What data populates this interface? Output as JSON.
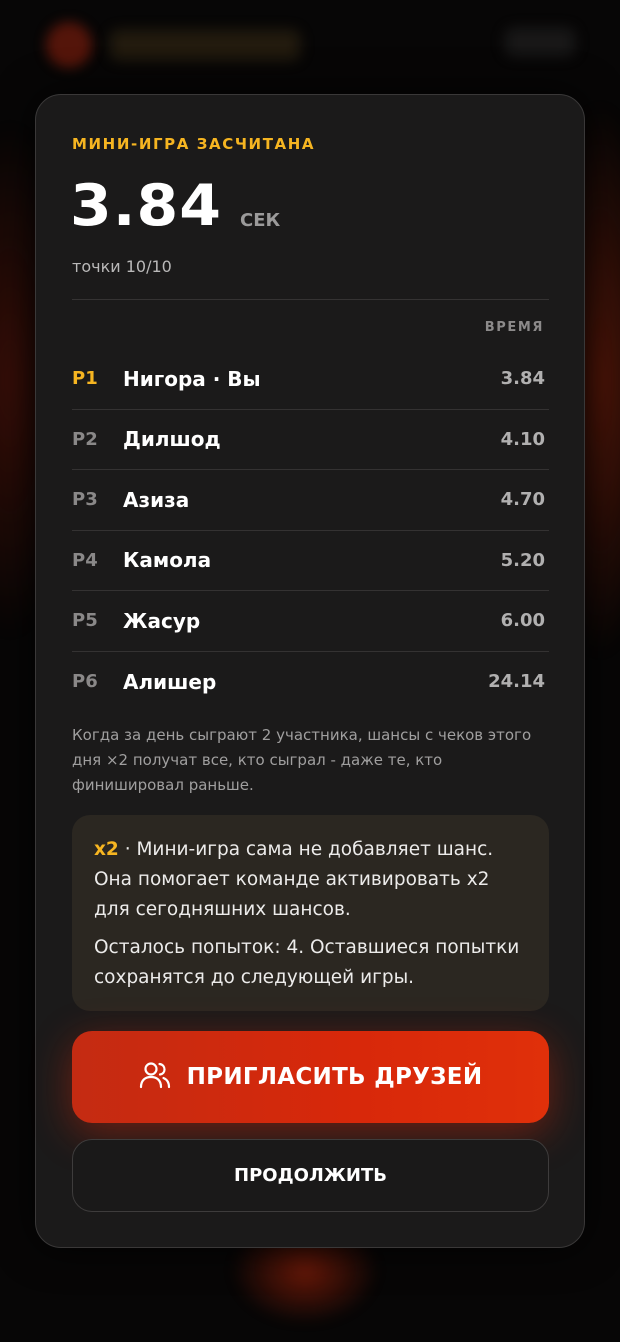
{
  "result": {
    "eyebrow": "МИНИ-ИГРА ЗАСЧИТАНА",
    "score_value": "3.84",
    "score_unit": "СЕК",
    "points_label": "точки 10/10"
  },
  "leaderboard": {
    "column_header": "ВРЕМЯ",
    "rows": [
      {
        "rank": "P1",
        "name": "Нигора · Вы",
        "time": "3.84"
      },
      {
        "rank": "P2",
        "name": "Дилшод",
        "time": "4.10"
      },
      {
        "rank": "P3",
        "name": "Азиза",
        "time": "4.70"
      },
      {
        "rank": "P4",
        "name": "Камола",
        "time": "5.20"
      },
      {
        "rank": "P5",
        "name": "Жасур",
        "time": "6.00"
      },
      {
        "rank": "P6",
        "name": "Алишер",
        "time": "24.14"
      }
    ]
  },
  "note": "Когда за день сыграют 2 участника, шансы с чеков этого дня ×2 получат все, кто сыграл - даже те, кто финишировал раньше.",
  "info": {
    "highlight": "x2",
    "line1_rest": " · Мини-игра сама не добавляет шанс. Она помогает команде активировать x2 для сегодняшних шансов.",
    "line2": "Осталось попыток: 4. Оставшиеся попытки сохранятся до следующей игры."
  },
  "buttons": {
    "invite_label": "ПРИГЛАСИТЬ ДРУЗЕЙ",
    "invite_icon": "users-icon",
    "continue_label": "ПРОДОЛЖИТЬ"
  },
  "colors": {
    "accent": "#f6b521",
    "primary_button": "#d8280a",
    "card_bg": "#1b1a1a"
  }
}
